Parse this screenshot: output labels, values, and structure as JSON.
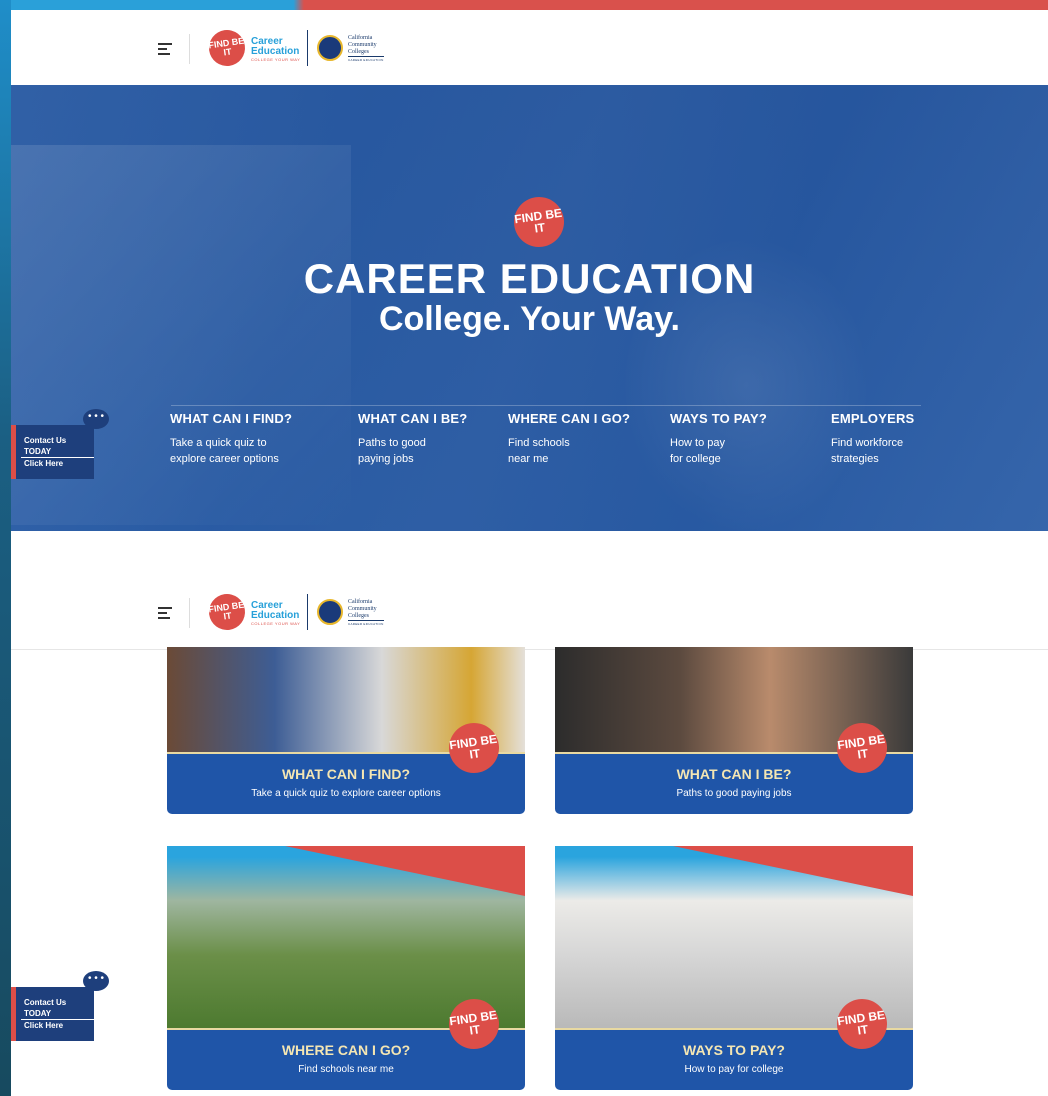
{
  "header": {
    "logo_text": "FIND BE IT",
    "brand_line1": "Career",
    "brand_line2": "Education",
    "brand_tagline": "COLLEGE YOUR WAY",
    "partner_line1": "California",
    "partner_line2": "Community",
    "partner_line3": "Colleges",
    "partner_sub": "CAREER EDUCATION"
  },
  "hero": {
    "title": "CAREER EDUCATION",
    "subtitle": "College. Your Way.",
    "nav": [
      {
        "title": "WHAT CAN I FIND?",
        "desc": "Take a quick quiz to explore career options"
      },
      {
        "title": "WHAT CAN I BE?",
        "desc": "Paths to good paying jobs"
      },
      {
        "title": "WHERE CAN I GO?",
        "desc": "Find schools near me"
      },
      {
        "title": "WAYS TO PAY?",
        "desc": "How to pay for college"
      },
      {
        "title": "EMPLOYERS",
        "desc": "Find workforce strategies"
      }
    ]
  },
  "contact": {
    "line1": "Contact Us",
    "line2": "TODAY",
    "line3": "Click Here",
    "bubble": "• • •"
  },
  "cards": [
    {
      "title": "WHAT CAN I FIND?",
      "desc": "Take a quick quiz to explore career options"
    },
    {
      "title": "WHAT CAN I BE?",
      "desc": "Paths to good paying jobs"
    },
    {
      "title": "WHERE CAN I GO?",
      "desc": "Find schools near me"
    },
    {
      "title": "WAYS TO PAY?",
      "desc": "How to pay for college"
    }
  ],
  "colors": {
    "brand_blue": "#1f55a8",
    "brand_red": "#dc4e48",
    "brand_cyan": "#27a0d9",
    "card_title": "#f4e6b3"
  }
}
